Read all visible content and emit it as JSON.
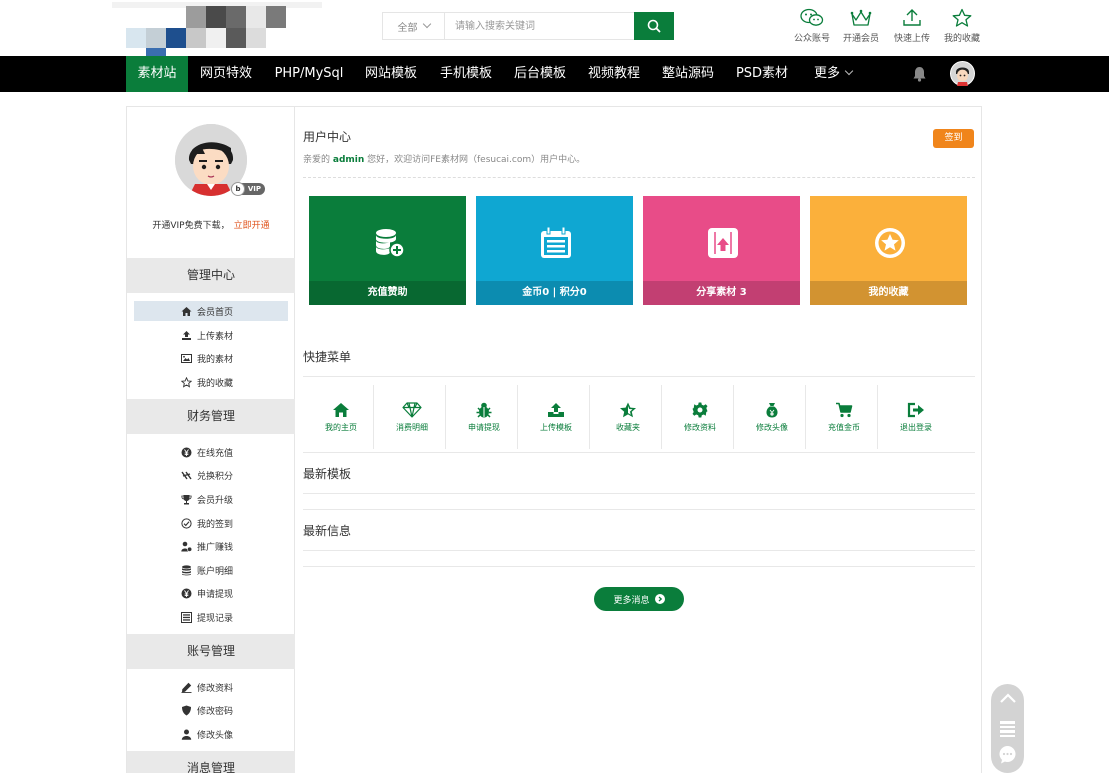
{
  "search": {
    "scope_label": "全部",
    "placeholder": "请输入搜索关键词"
  },
  "quick_links": [
    {
      "label": "公众账号",
      "icon": "wechat-icon"
    },
    {
      "label": "开通会员",
      "icon": "crown-icon"
    },
    {
      "label": "快速上传",
      "icon": "upload-icon"
    },
    {
      "label": "我的收藏",
      "icon": "star-icon"
    }
  ],
  "nav": {
    "items": [
      "素材站",
      "网页特效",
      "PHP/MySql",
      "网站模板",
      "手机模板",
      "后台模板",
      "视频教程",
      "整站源码",
      "PSD素材",
      "更多"
    ],
    "active_index": 0
  },
  "sidebar": {
    "vip_prompt": "开通VIP免费下载，",
    "vip_link": "立即开通",
    "vip_badge": "VIP",
    "vip_badge_letter": "b",
    "sections": [
      {
        "title": "管理中心",
        "items": [
          {
            "label": "会员首页",
            "icon": "home-icon",
            "selected": true
          },
          {
            "label": "上传素材",
            "icon": "upload-icon"
          },
          {
            "label": "我的素材",
            "icon": "image-icon"
          },
          {
            "label": "我的收藏",
            "icon": "star-outline-icon"
          }
        ]
      },
      {
        "title": "财务管理",
        "items": [
          {
            "label": "在线充值",
            "icon": "yen-icon"
          },
          {
            "label": "兑换积分",
            "icon": "exchange-icon"
          },
          {
            "label": "会员升级",
            "icon": "trophy-icon"
          },
          {
            "label": "我的签到",
            "icon": "check-circle-icon"
          },
          {
            "label": "推广赚钱",
            "icon": "user-money-icon"
          },
          {
            "label": "账户明细",
            "icon": "database-icon"
          },
          {
            "label": "申请提现",
            "icon": "yen-icon"
          },
          {
            "label": "提现记录",
            "icon": "list-icon"
          }
        ]
      },
      {
        "title": "账号管理",
        "items": [
          {
            "label": "修改资料",
            "icon": "edit-icon"
          },
          {
            "label": "修改密码",
            "icon": "shield-icon"
          },
          {
            "label": "修改头像",
            "icon": "user-icon"
          }
        ]
      },
      {
        "title": "消息管理",
        "items": []
      }
    ]
  },
  "main": {
    "title": "用户中心",
    "welcome_prefix": "亲爱的 ",
    "username": "admin",
    "welcome_suffix": " 您好，欢迎访问FE素材网（fesucai.com）用户中心。",
    "signin_label": "签到",
    "tiles": [
      {
        "label": "充值赞助",
        "color": "#0a7d3b",
        "icon": "coins-add-icon"
      },
      {
        "label": "金币0 | 积分0",
        "color": "#0fa7d2",
        "icon": "calendar-icon"
      },
      {
        "label": "分享素材 3",
        "color": "#e84c88",
        "icon": "share-upload-icon"
      },
      {
        "label": "我的收藏",
        "color": "#fbb03b",
        "icon": "star-circle-icon"
      }
    ],
    "quick_menu_title": "快捷菜单",
    "quick_menu": [
      {
        "label": "我的主页",
        "icon": "home-icon"
      },
      {
        "label": "消费明细",
        "icon": "diamond-icon"
      },
      {
        "label": "申请提现",
        "icon": "bug-icon"
      },
      {
        "label": "上传模板",
        "icon": "upload-icon"
      },
      {
        "label": "收藏夹",
        "icon": "star-half-icon"
      },
      {
        "label": "修改资料",
        "icon": "gear-icon"
      },
      {
        "label": "修改头像",
        "icon": "money-bag-icon"
      },
      {
        "label": "充值金币",
        "icon": "cart-icon"
      },
      {
        "label": "退出登录",
        "icon": "logout-icon"
      }
    ],
    "latest_templates_title": "最新模板",
    "latest_info_title": "最新信息",
    "more_button": "更多消息"
  },
  "colors": {
    "brand_green": "#0a7d3b",
    "orange": "#f0851b",
    "nav_bg": "#000000"
  }
}
